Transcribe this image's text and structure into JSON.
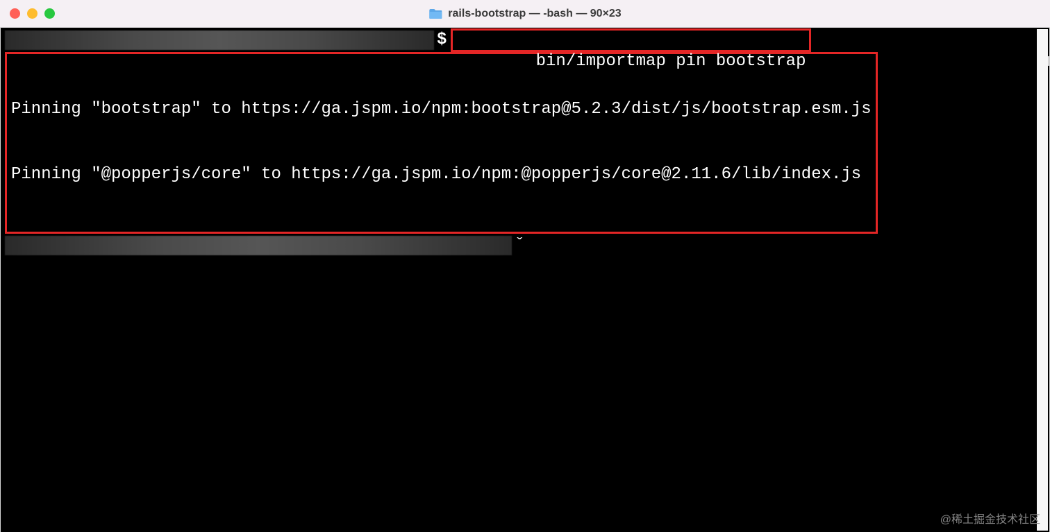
{
  "titlebar": {
    "title": "rails-bootstrap — -bash — 90×23"
  },
  "terminal": {
    "prompt_symbol": "$",
    "command": "bin/importmap pin bootstrap",
    "output": [
      "Pinning \"bootstrap\" to https://ga.jspm.io/npm:bootstrap@5.2.3/dist/js/bootstrap.esm.js",
      "Pinning \"@popperjs/core\" to https://ga.jspm.io/npm:@popperjs/core@2.11.6/lib/index.js"
    ],
    "cursor_char": "ˇ"
  },
  "watermark": "@稀土掘金技术社区"
}
